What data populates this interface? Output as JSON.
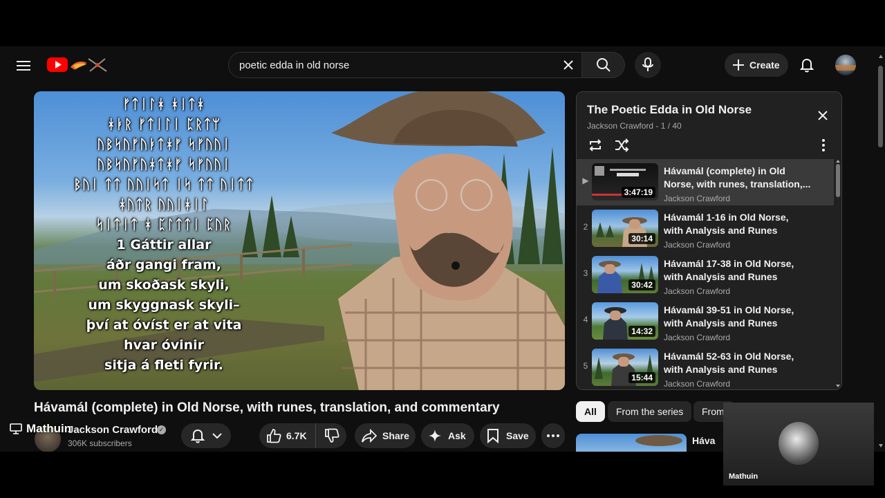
{
  "search": {
    "value": "poetic edda in old norse"
  },
  "header": {
    "create_label": "Create"
  },
  "video": {
    "title": "Hávamál (complete) in Old Norse, with runes, translation, and commentary",
    "overlay_runes": [
      "ᚠᛏᛁᛚᚼ ᚼᛁᛏᚼ",
      "ᚼᛓᚱ ᚠᛏᛁᛚᛁ ᛈᚱᛏᛘ",
      "ᚢᛒᛋᚢᚠᚢᛓᛏᚼᚠ ᛋᚠᚢᚢᛁ",
      "ᚢᛒᛋᚢᚠᚢᚼᛏᚼᚠ ᛋᚠᚢᚢᛁ",
      "ᛒᚢᛁ ᛏᛏ ᚢᚢᛁᛋᛏ ᛁᛋ ᛏᛏ ᚢᛁᛏᛏ",
      "ᚼᚢᛏᚱ ᚢᚢᛁᚼᛁᛚ",
      "ᛋᛁᛏᛁᛏ ᚼ ᛈᛚᛏᛏᛁ ᛈᚢᚱ"
    ],
    "overlay_lines": [
      "1 Gáttir allar",
      "áðr gangi fram,",
      "um skoðask skyli,",
      "um skyggnask skyli–",
      "því at óvíst er at vita",
      "hvar óvinir",
      "sitja á fleti fyrir."
    ]
  },
  "channel": {
    "name": "Jackson Crawford",
    "subscribers": "306K subscribers"
  },
  "actions": {
    "likes": "6.7K",
    "share": "Share",
    "ask": "Ask",
    "save": "Save"
  },
  "playlist": {
    "title": "The Poetic Edda in Old Norse",
    "subtitle": "Jackson Crawford - 1 / 40",
    "items": [
      {
        "index": "▶",
        "title_l1": "Hávamál (complete) in Old",
        "title_l2": "Norse, with runes, translation,...",
        "channel": "Jackson Crawford",
        "duration": "3:47:19"
      },
      {
        "index": "2",
        "title_l1": "Hávamál 1-16 in Old Norse,",
        "title_l2": "with Analysis and Runes",
        "channel": "Jackson Crawford",
        "duration": "30:14"
      },
      {
        "index": "3",
        "title_l1": "Hávamál 17-38 in Old Norse,",
        "title_l2": "with Analysis and Runes",
        "channel": "Jackson Crawford",
        "duration": "30:42"
      },
      {
        "index": "4",
        "title_l1": "Hávamál 39-51 in Old Norse,",
        "title_l2": "with Analysis and Runes",
        "channel": "Jackson Crawford",
        "duration": "14:32"
      },
      {
        "index": "5",
        "title_l1": "Hávamál 52-63 in Old Norse,",
        "title_l2": "with Analysis and Runes",
        "channel": "Jackson Crawford",
        "duration": "15:44"
      }
    ]
  },
  "chips": [
    "All",
    "From the series",
    "From"
  ],
  "recommendation": {
    "title": "Háva"
  },
  "presenter": {
    "name": "Mathuin"
  },
  "camera": {
    "name": "Mathuin"
  },
  "colors": {
    "background": "#0f0f0f",
    "panel": "#212121",
    "active_item": "#3a3a3a",
    "pill": "#272727",
    "brand_red": "#ff0000"
  }
}
